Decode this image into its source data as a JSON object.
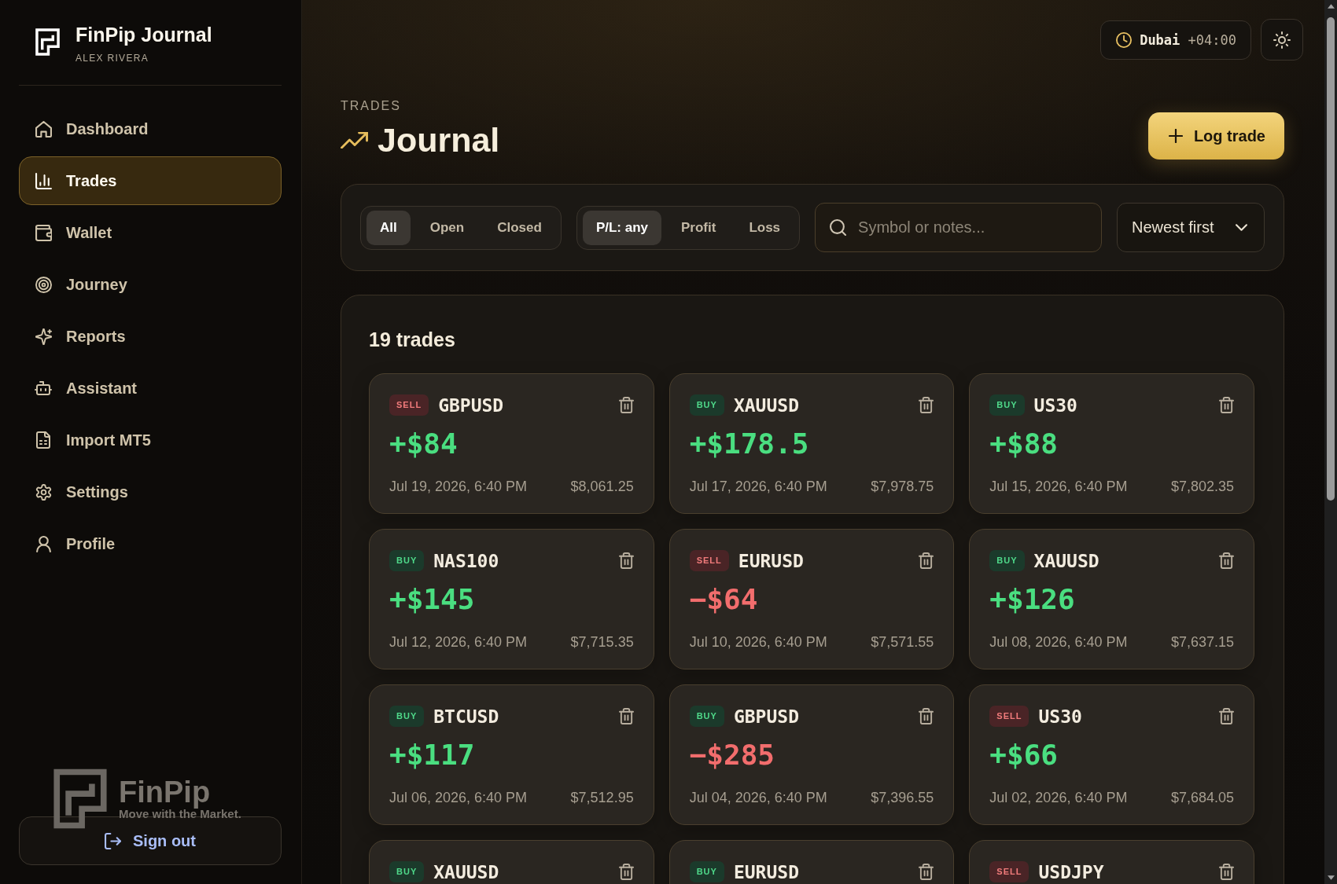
{
  "sidebar": {
    "brand": {
      "title": "FinPip Journal",
      "subtitle": "ALEX RIVERA"
    },
    "nav": [
      {
        "label": "Dashboard",
        "selected": false
      },
      {
        "label": "Trades",
        "selected": true
      },
      {
        "label": "Wallet",
        "selected": false
      },
      {
        "label": "Journey",
        "selected": false
      },
      {
        "label": "Reports",
        "selected": false
      },
      {
        "label": "Assistant",
        "selected": false
      },
      {
        "label": "Import MT5",
        "selected": false
      },
      {
        "label": "Settings",
        "selected": false
      },
      {
        "label": "Profile",
        "selected": false
      }
    ],
    "logo_mark": {
      "name": "FinPip",
      "tagline": "Move with the Market."
    },
    "sign_out": {
      "label": "Sign out"
    }
  },
  "header": {
    "timezone": {
      "city": "Dubai",
      "offset": "+04:00"
    },
    "eyebrow": "TRADES",
    "title": "Journal",
    "action": {
      "label": "Log trade"
    }
  },
  "filters": {
    "status": [
      {
        "label": "All",
        "selected": true
      },
      {
        "label": "Open",
        "selected": false
      },
      {
        "label": "Closed",
        "selected": false
      }
    ],
    "pl": [
      {
        "label": "P/L: any",
        "selected": true
      },
      {
        "label": "Profit",
        "selected": false
      },
      {
        "label": "Loss",
        "selected": false
      }
    ],
    "search": {
      "placeholder": "Symbol or notes..."
    },
    "sort": {
      "value": "Newest first"
    }
  },
  "trades": {
    "count": "19 trades",
    "cards": [
      {
        "side": {
          "label": "SELL",
          "kind": "sell"
        },
        "symbol": "GBPUSD",
        "pl": {
          "text": "+$84",
          "kind": "gain"
        },
        "date": "Jul 19, 2026, 6:40 PM",
        "balance": "$8,061.25"
      },
      {
        "side": {
          "label": "BUY",
          "kind": "buy"
        },
        "symbol": "XAUUSD",
        "pl": {
          "text": "+$178.5",
          "kind": "gain"
        },
        "date": "Jul 17, 2026, 6:40 PM",
        "balance": "$7,978.75"
      },
      {
        "side": {
          "label": "BUY",
          "kind": "buy"
        },
        "symbol": "US30",
        "pl": {
          "text": "+$88",
          "kind": "gain"
        },
        "date": "Jul 15, 2026, 6:40 PM",
        "balance": "$7,802.35"
      },
      {
        "side": {
          "label": "BUY",
          "kind": "buy"
        },
        "symbol": "NAS100",
        "pl": {
          "text": "+$145",
          "kind": "gain"
        },
        "date": "Jul 12, 2026, 6:40 PM",
        "balance": "$7,715.35"
      },
      {
        "side": {
          "label": "SELL",
          "kind": "sell"
        },
        "symbol": "EURUSD",
        "pl": {
          "text": "−$64",
          "kind": "loss"
        },
        "date": "Jul 10, 2026, 6:40 PM",
        "balance": "$7,571.55"
      },
      {
        "side": {
          "label": "BUY",
          "kind": "buy"
        },
        "symbol": "XAUUSD",
        "pl": {
          "text": "+$126",
          "kind": "gain"
        },
        "date": "Jul 08, 2026, 6:40 PM",
        "balance": "$7,637.15"
      },
      {
        "side": {
          "label": "BUY",
          "kind": "buy"
        },
        "symbol": "BTCUSD",
        "pl": {
          "text": "+$117",
          "kind": "gain"
        },
        "date": "Jul 06, 2026, 6:40 PM",
        "balance": "$7,512.95"
      },
      {
        "side": {
          "label": "BUY",
          "kind": "buy"
        },
        "symbol": "GBPUSD",
        "pl": {
          "text": "−$285",
          "kind": "loss"
        },
        "date": "Jul 04, 2026, 6:40 PM",
        "balance": "$7,396.55"
      },
      {
        "side": {
          "label": "SELL",
          "kind": "sell"
        },
        "symbol": "US30",
        "pl": {
          "text": "+$66",
          "kind": "gain"
        },
        "date": "Jul 02, 2026, 6:40 PM",
        "balance": "$7,684.05"
      },
      {
        "side": {
          "label": "BUY",
          "kind": "buy"
        },
        "symbol": "XAUUSD"
      },
      {
        "side": {
          "label": "BUY",
          "kind": "buy"
        },
        "symbol": "EURUSD"
      },
      {
        "side": {
          "label": "SELL",
          "kind": "sell"
        },
        "symbol": "USDJPY"
      }
    ]
  }
}
